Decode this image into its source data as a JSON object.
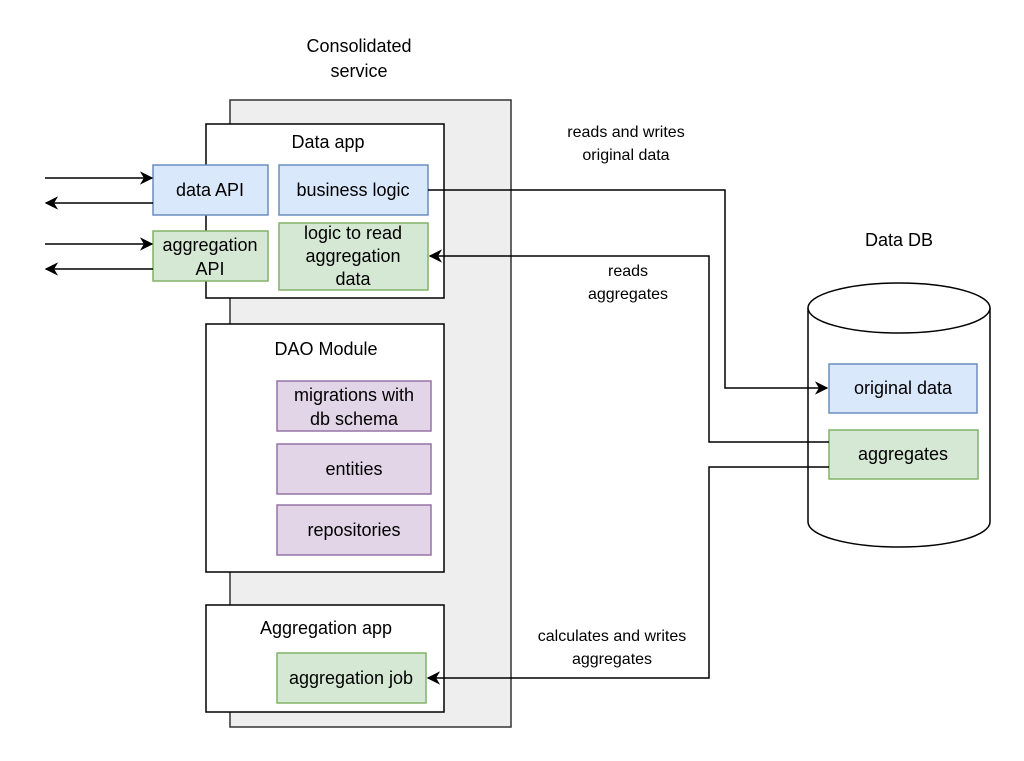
{
  "service": {
    "title_lines": [
      "Consolidated",
      "service"
    ]
  },
  "data_app": {
    "title": "Data app",
    "data_api": "data API",
    "business_logic": "business logic",
    "aggregation_api_lines": [
      "aggregation",
      "API"
    ],
    "read_logic_lines": [
      "logic to read",
      "aggregation",
      "data"
    ]
  },
  "dao": {
    "title": "DAO Module",
    "migrations_lines": [
      "migrations with",
      "db schema"
    ],
    "entities": "entities",
    "repositories": "repositories"
  },
  "aggregation_app": {
    "title": "Aggregation app",
    "job": "aggregation job"
  },
  "db": {
    "title": "Data DB",
    "original": "original data",
    "aggregates": "aggregates"
  },
  "edges": {
    "rw_lines": [
      "reads and writes",
      "original data"
    ],
    "read_agg_lines": [
      "reads",
      "aggregates"
    ],
    "calc_lines": [
      "calculates and writes",
      "aggregates"
    ]
  },
  "colors": {
    "blue_fill": "#dae8fc",
    "blue_stroke": "#6c8ebf",
    "green_fill": "#d5e8d4",
    "green_stroke": "#82b366",
    "purple_fill": "#e1d5e7",
    "purple_stroke": "#9673a6",
    "container_fill": "#eeeeee"
  }
}
